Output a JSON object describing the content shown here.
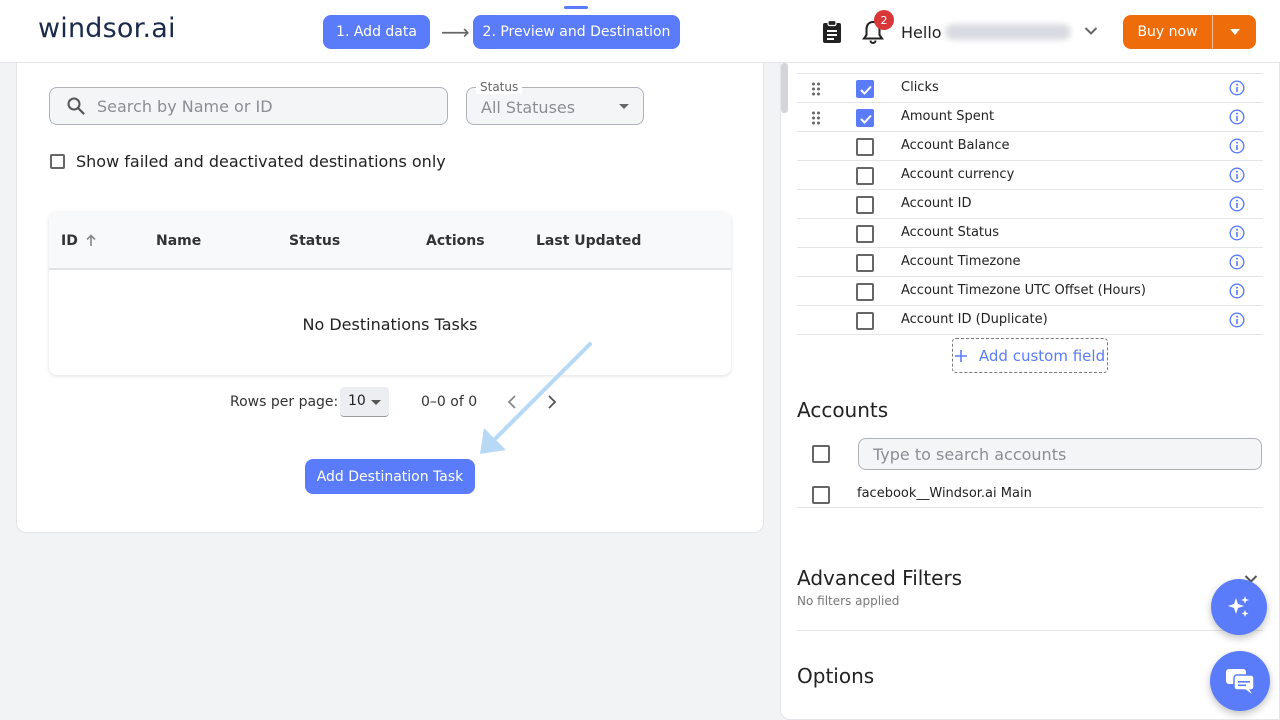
{
  "header": {
    "logo": "windsor.ai",
    "steps": [
      "1. Add data",
      "2. Preview and Destination"
    ],
    "notification_count": "2",
    "greeting": "Hello",
    "buy_label": "Buy now"
  },
  "destinations": {
    "search_placeholder": "Search by Name or ID",
    "status_label": "Status",
    "status_value": "All Statuses",
    "failed_only_label": "Show failed and deactivated destinations only",
    "columns": [
      "ID",
      "Name",
      "Status",
      "Actions",
      "Last Updated"
    ],
    "empty_message": "No Destinations Tasks",
    "rows_per_page_label": "Rows per page:",
    "rows_per_page_value": "10",
    "page_range": "0–0 of 0",
    "add_button": "Add Destination Task"
  },
  "fields": {
    "items": [
      {
        "label": "Clicks",
        "checked": true
      },
      {
        "label": "Amount Spent",
        "checked": true
      },
      {
        "label": "Account Balance",
        "checked": false
      },
      {
        "label": "Account currency",
        "checked": false
      },
      {
        "label": "Account ID",
        "checked": false
      },
      {
        "label": "Account Status",
        "checked": false
      },
      {
        "label": "Account Timezone",
        "checked": false
      },
      {
        "label": "Account Timezone UTC Offset (Hours)",
        "checked": false
      },
      {
        "label": "Account ID (Duplicate)",
        "checked": false
      }
    ],
    "add_custom_label": "Add custom field"
  },
  "accounts": {
    "title": "Accounts",
    "search_placeholder": "Type to search accounts",
    "items": [
      "facebook__Windsor.ai Main"
    ]
  },
  "advanced_filters": {
    "title": "Advanced Filters",
    "subtitle": "No filters applied"
  },
  "options": {
    "title": "Options"
  },
  "colors": {
    "accent": "#5b7cfa",
    "buy": "#ef6c0a",
    "badge": "#d9383a"
  }
}
